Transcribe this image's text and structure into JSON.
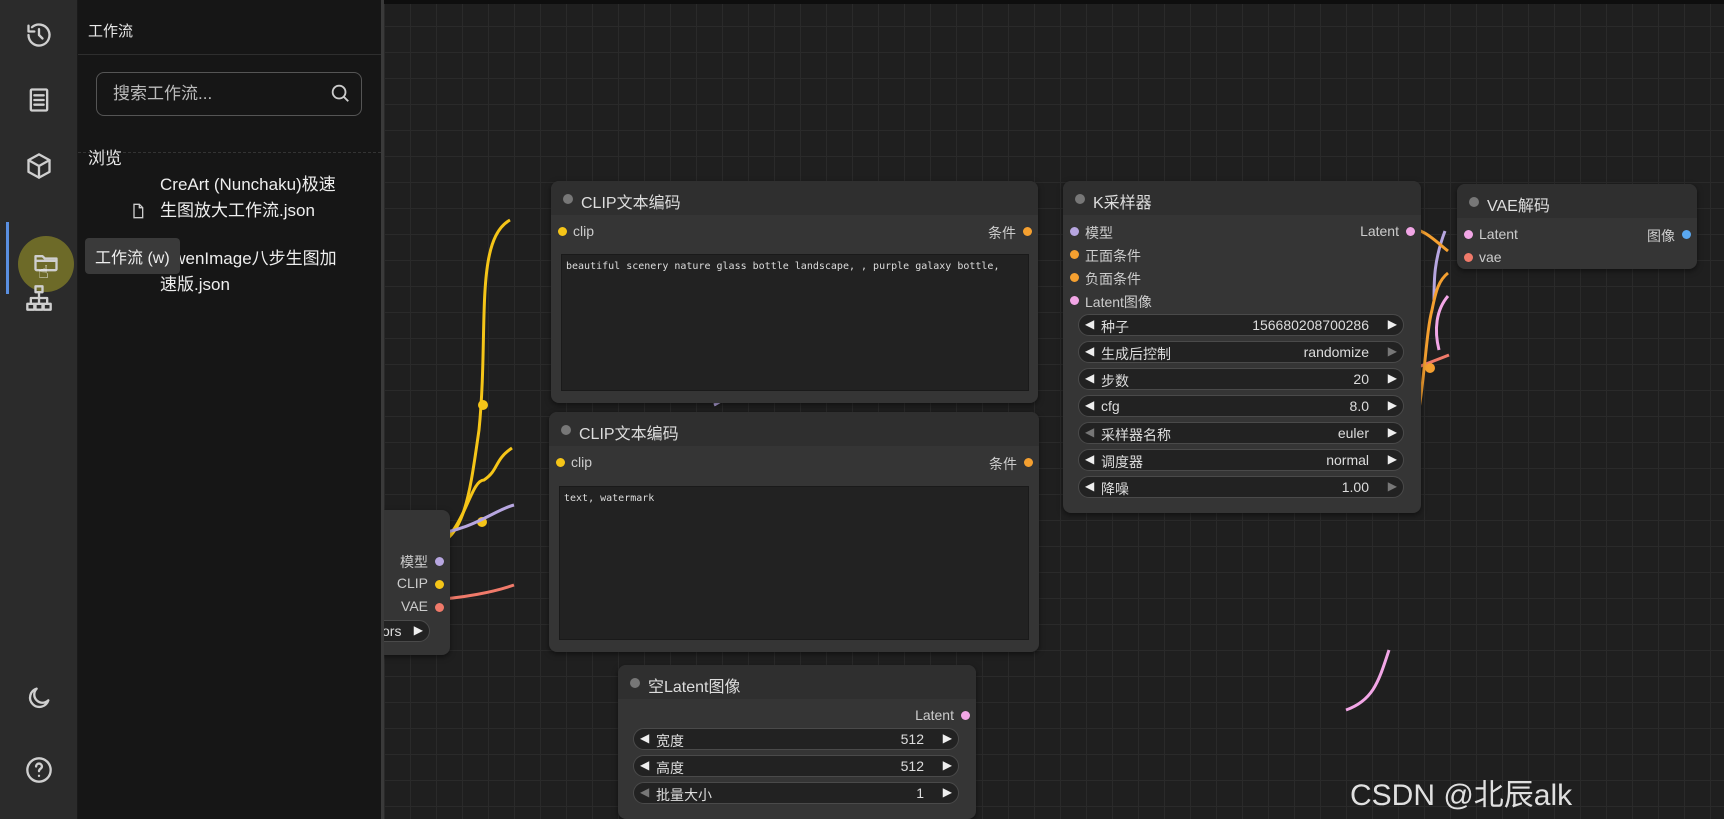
{
  "sidebar": {
    "icons": [
      "history-icon",
      "queue-icon",
      "model-library-icon",
      "workflows-folder-icon",
      "node-library-icon",
      "theme-moon-icon",
      "help-icon"
    ],
    "active_color": "#6d6a28"
  },
  "tooltip": {
    "text": "工作流 (w)"
  },
  "panel": {
    "title": "工作流",
    "search_placeholder": "搜索工作流...",
    "browse_label": "浏览",
    "workflows": [
      {
        "name": "CreArt (Nunchaku)极速生图放大工作流.json"
      },
      {
        "name": "QwenImage八步生图加速版.json"
      }
    ]
  },
  "nodes": {
    "clip_pos": {
      "title": "CLIP文本编码",
      "input_clip": "clip",
      "output": "条件",
      "text": "beautiful scenery nature glass bottle landscape, , purple galaxy bottle,"
    },
    "clip_neg": {
      "title": "CLIP文本编码",
      "input_clip": "clip",
      "output": "条件",
      "text": "text, watermark"
    },
    "checkpoint": {
      "out_model": "模型",
      "out_clip": "CLIP",
      "out_vae": "VAE",
      "widget_partial": "sors"
    },
    "ksampler": {
      "title": "K采样器",
      "in_model": "模型",
      "in_pos": "正面条件",
      "in_neg": "负面条件",
      "in_latent": "Latent图像",
      "out_latent": "Latent",
      "widgets": [
        {
          "label": "种子",
          "value": "156680208700286"
        },
        {
          "label": "生成后控制",
          "value": "randomize"
        },
        {
          "label": "步数",
          "value": "20"
        },
        {
          "label": "cfg",
          "value": "8.0"
        },
        {
          "label": "采样器名称",
          "value": "euler"
        },
        {
          "label": "调度器",
          "value": "normal"
        },
        {
          "label": "降噪",
          "value": "1.00"
        }
      ]
    },
    "vae_decode": {
      "title": "VAE解码",
      "in_latent": "Latent",
      "in_vae": "vae",
      "out_image": "图像"
    },
    "empty_latent": {
      "title": "空Latent图像",
      "out_latent": "Latent",
      "widgets": [
        {
          "label": "宽度",
          "value": "512"
        },
        {
          "label": "高度",
          "value": "512"
        },
        {
          "label": "批量大小",
          "value": "1"
        }
      ]
    }
  },
  "colors": {
    "clip_wire": "#f5c518",
    "model_wire": "#b7a6e0",
    "vae_wire": "#f07a6a",
    "cond_wire": "#f5a030",
    "latent_wire": "#f2a6e6",
    "image_wire": "#5aa8f0"
  },
  "watermark": "CSDN @北辰alk"
}
